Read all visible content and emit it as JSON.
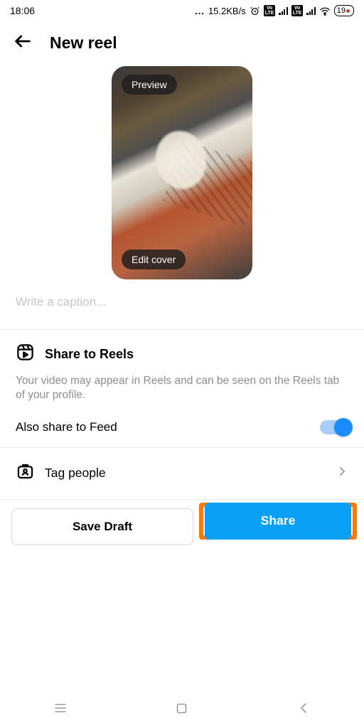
{
  "statusbar": {
    "time": "18:06",
    "net_speed": "15.2KB/s",
    "battery_pct": "19"
  },
  "header": {
    "title": "New reel"
  },
  "preview": {
    "preview_label": "Preview",
    "edit_cover_label": "Edit cover"
  },
  "caption": {
    "placeholder": "Write a caption..."
  },
  "reels_section": {
    "title": "Share to Reels",
    "description": "Your video may appear in Reels and can be seen on the Reels tab of your profile.",
    "also_share_label": "Also share to Feed"
  },
  "tag_section": {
    "label": "Tag people"
  },
  "buttons": {
    "save_draft": "Save Draft",
    "share": "Share"
  },
  "colors": {
    "accent": "#0aa0f5",
    "highlight": "#ff7a00",
    "toggle": "#1a8cff"
  }
}
